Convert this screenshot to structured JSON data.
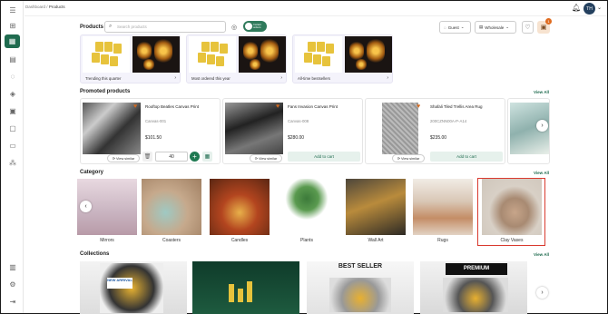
{
  "header": {
    "breadcrumb_root": "Dashboard",
    "breadcrumb_sep": "/",
    "breadcrumb_current": "Products",
    "avatar_initials": "TH"
  },
  "products": {
    "title": "Products",
    "search_placeholder": "Search products",
    "toggle_label": "Instant orders",
    "guest_label": "Guest",
    "wholesale_label": "Wholesale",
    "cart_count": "1"
  },
  "quick_collections": [
    {
      "label": "Trending this quarter"
    },
    {
      "label": "Most ordered this year"
    },
    {
      "label": "All-time bestsellers"
    }
  ],
  "promoted": {
    "title": "Promoted products",
    "view_all": "View All",
    "items": [
      {
        "name": "Rooftop Beatles Canvas Print",
        "sku": "Canvas-001",
        "price": "$101.50",
        "view_similar": "View similar"
      },
      {
        "name": "Fans Invasion Canvas Print",
        "sku": "Canvas-008",
        "price": "$280.00",
        "view_similar": "View similar",
        "cta": "Add to cart"
      },
      {
        "name": "Shafali Tiled Trellis Area Rug",
        "sku": "200CZNN00A-P-A14",
        "price": "$235.00",
        "view_similar": "View similar",
        "cta": "Add to cart"
      }
    ],
    "qty": "40"
  },
  "category": {
    "title": "Category",
    "view_all": "View All",
    "items": [
      {
        "label": "Mirrors"
      },
      {
        "label": "Coasters"
      },
      {
        "label": "Candles"
      },
      {
        "label": "Plants"
      },
      {
        "label": "Wall Art"
      },
      {
        "label": "Rugs"
      },
      {
        "label": "Clay Vases"
      }
    ]
  },
  "collections": {
    "title": "Collections",
    "view_all": "View All",
    "banner_1": "NEW ARRIVAL",
    "banner_2": "BEST SELLER",
    "banner_3": "PREMIUM"
  },
  "colors": {
    "accent": "#1f6b4f",
    "highlight": "#d93a2f"
  }
}
